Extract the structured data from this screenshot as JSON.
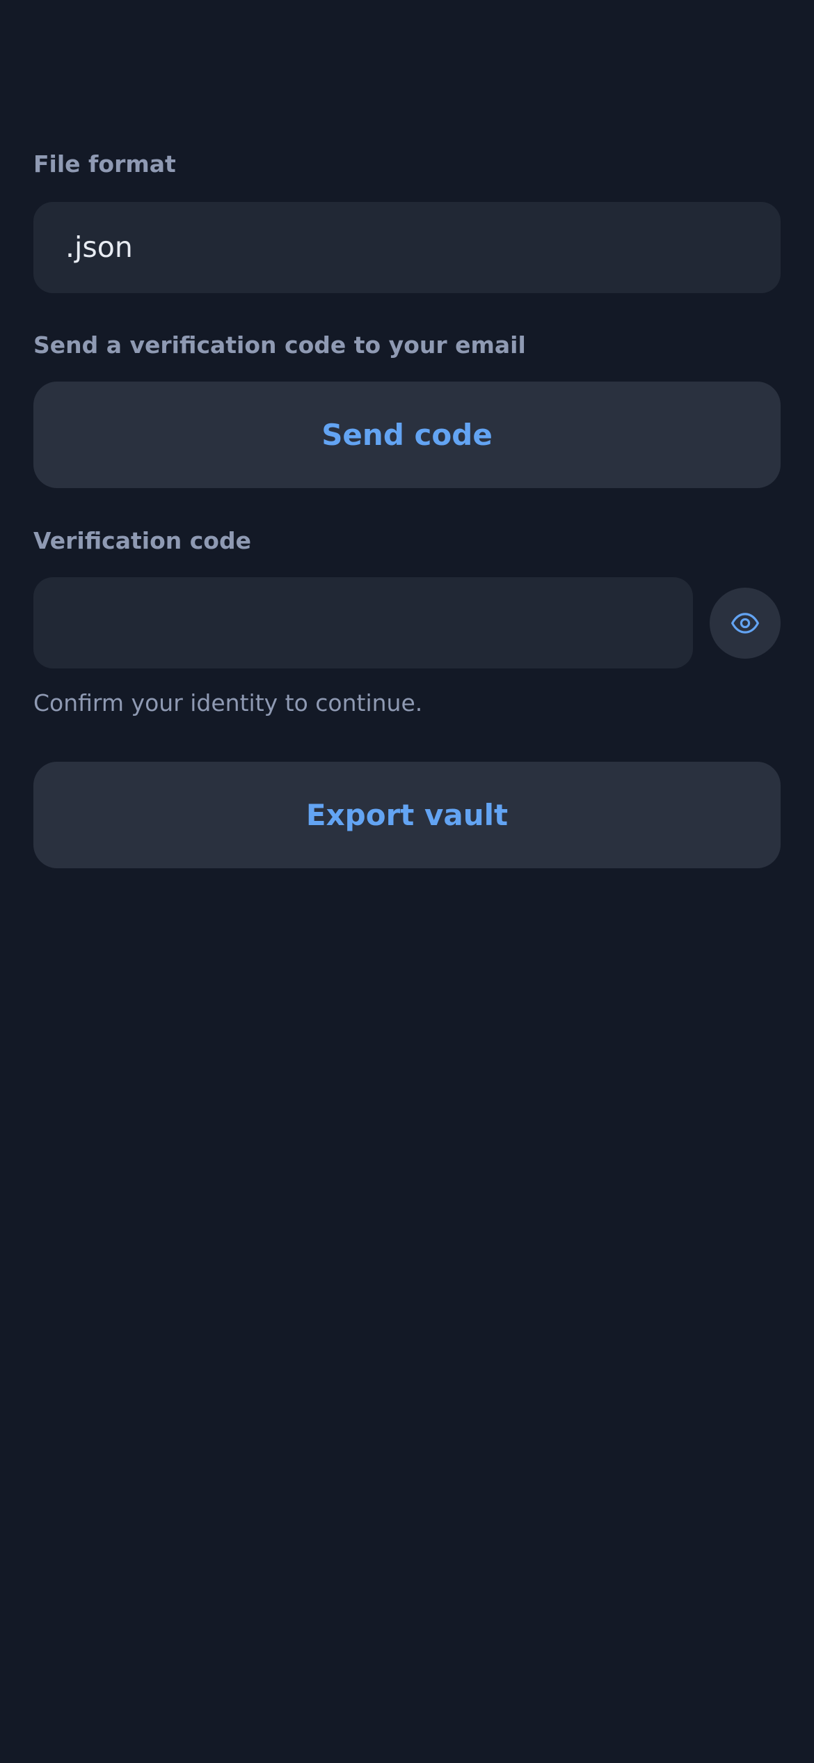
{
  "file_format": {
    "label": "File format",
    "value": ".json"
  },
  "send_code": {
    "label": "Send a verification code to your email",
    "button_label": "Send code"
  },
  "verification": {
    "label": "Verification code",
    "value": "",
    "toggle_icon": "eye-icon",
    "helper": "Confirm your identity to continue."
  },
  "export": {
    "button_label": "Export vault"
  },
  "colors": {
    "background": "#131926",
    "field": "#212835",
    "button": "#2a313f",
    "accent": "#63a4f3",
    "label": "#8f9ab3",
    "text": "#e8ecf3"
  }
}
